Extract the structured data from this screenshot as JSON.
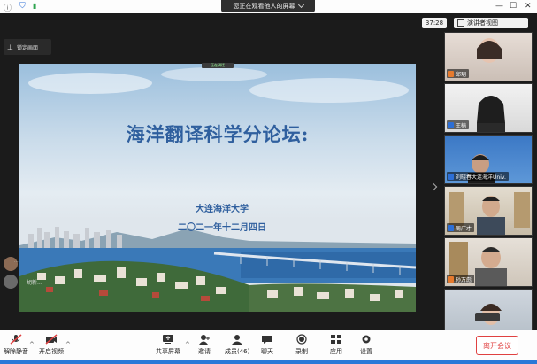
{
  "top": {
    "share_banner": "您正在观看他人的屏幕",
    "timer": "37:28",
    "view_button": "演讲者视图"
  },
  "pin": {
    "label": "锁定画面"
  },
  "slide": {
    "title": "海洋翻译科学分论坛:",
    "subtitle": "大连海洋大学",
    "date": "二〇二一年十二月四日",
    "speaker_chip": "正在讲话"
  },
  "floating": [
    {
      "name": "..."
    },
    {
      "name": "胡新..."
    }
  ],
  "gallery": [
    {
      "name": "邱玥",
      "badge": "orange"
    },
    {
      "name": "王楠",
      "badge": "blue"
    },
    {
      "name": "刘晓春大连海洋Univ.",
      "badge": "blue"
    },
    {
      "name": "周广才",
      "badge": "blue"
    },
    {
      "name": "孙万彪",
      "badge": "orange"
    }
  ],
  "bottom": {
    "mute": "解除静音",
    "video": "开启视频",
    "share": "共享屏幕",
    "invite": "邀请",
    "participants": "成员(46)",
    "chat": "聊天",
    "record": "录制",
    "apps": "应用",
    "settings": "设置",
    "leave": "离开会议"
  },
  "colors": {
    "accent": "#2a78d8",
    "leave": "#e04141",
    "slide_title": "#2f5f9e"
  }
}
